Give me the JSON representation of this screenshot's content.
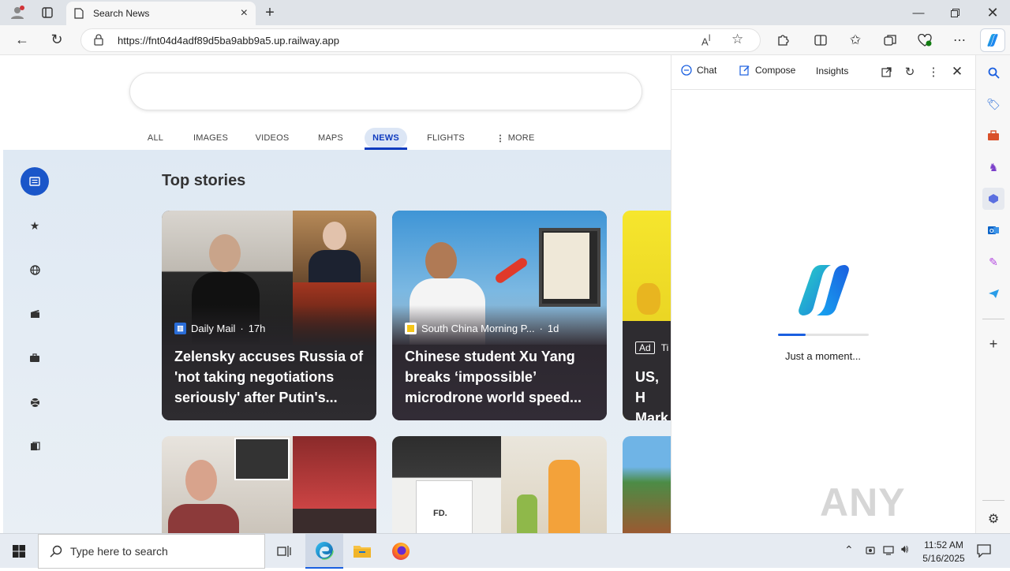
{
  "browser": {
    "tab_title": "Search News",
    "url": "https://fnt04d4adf89d5ba9abb9a5.up.railway.app"
  },
  "nav_tabs": [
    "ALL",
    "IMAGES",
    "VIDEOS",
    "MAPS",
    "NEWS",
    "FLIGHTS",
    "MORE"
  ],
  "active_tab": "NEWS",
  "section_title": "Top stories",
  "stories": [
    {
      "source": "Daily Mail",
      "age": "17h",
      "headline": "Zelensky accuses Russia of 'not taking negotiations seriously' after Putin's..."
    },
    {
      "source": "South China Morning P...",
      "age": "1d",
      "headline": "Chinese student Xu Yang breaks ‘impossible’ microdrone world speed..."
    },
    {
      "ad_label": "Ad",
      "source": "Ti",
      "headline": "US, H Mark"
    }
  ],
  "copilot": {
    "tabs": [
      "Chat",
      "Compose",
      "Insights"
    ],
    "loading_text": "Just a moment...",
    "progress": 0.3
  },
  "watermark": "ANY RUN",
  "taskbar": {
    "search_placeholder": "Type here to search",
    "time": "11:52 AM",
    "date": "5/16/2025"
  },
  "colors": {
    "accent": "#0f3bbf",
    "news_tab_bg": "#dce6f5",
    "card1_bg": "#3b3a38",
    "card2_bg": "#5aa0d8",
    "card3_bg": "#f3e22a"
  }
}
